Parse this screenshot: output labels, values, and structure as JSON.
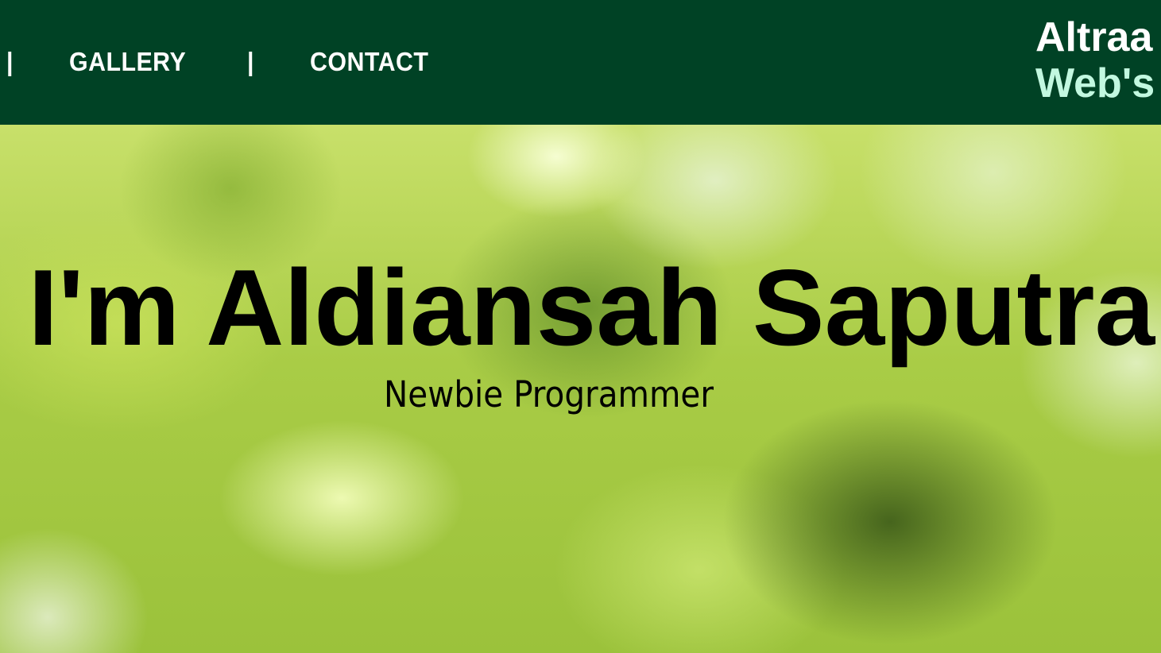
{
  "header": {
    "nav": {
      "separator": "|",
      "items": [
        {
          "label": "GALLERY"
        },
        {
          "label": "CONTACT"
        }
      ]
    },
    "brand": {
      "line1": "Altraa",
      "line2": "Web's"
    },
    "colors": {
      "background": "#004225",
      "nav_text": "#ffffff",
      "brand_line1": "#ffffff",
      "brand_line2": "#c2f8e0"
    }
  },
  "hero": {
    "title": "i, I'm Aldiansah Saputra",
    "subtitle": "Newbie Programmer",
    "colors": {
      "text": "#000000",
      "background_accent": "#a9cc46"
    }
  }
}
